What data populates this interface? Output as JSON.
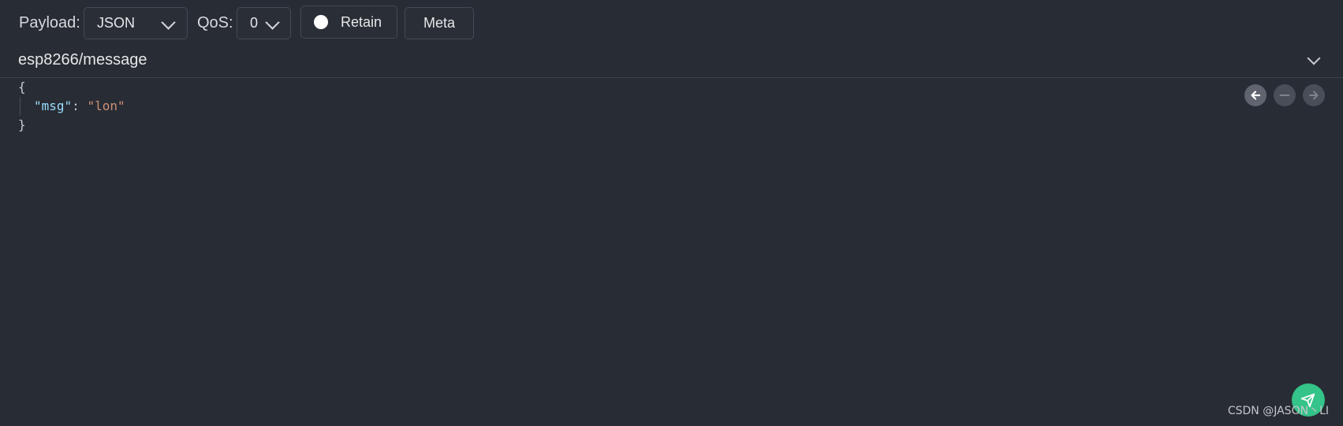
{
  "toolbar": {
    "payload_label": "Payload:",
    "payload_format": "JSON",
    "qos_label": "QoS:",
    "qos_value": "0",
    "retain_label": "Retain",
    "meta_label": "Meta"
  },
  "topic": {
    "value": "esp8266/message"
  },
  "editor": {
    "lines": [
      "{",
      "}"
    ],
    "key": "\"msg\"",
    "colon": ": ",
    "value": "\"lon\""
  },
  "history": {
    "prev_icon": "arrow-left-icon",
    "current_icon": "minus-icon",
    "next_icon": "arrow-right-icon"
  },
  "send": {
    "icon": "send-icon",
    "color": "#34c388"
  },
  "watermark": "CSDN @JASON丶LI",
  "colors": {
    "background": "#282c34",
    "json_key": "#9cdcfe",
    "json_string": "#ce9178"
  }
}
